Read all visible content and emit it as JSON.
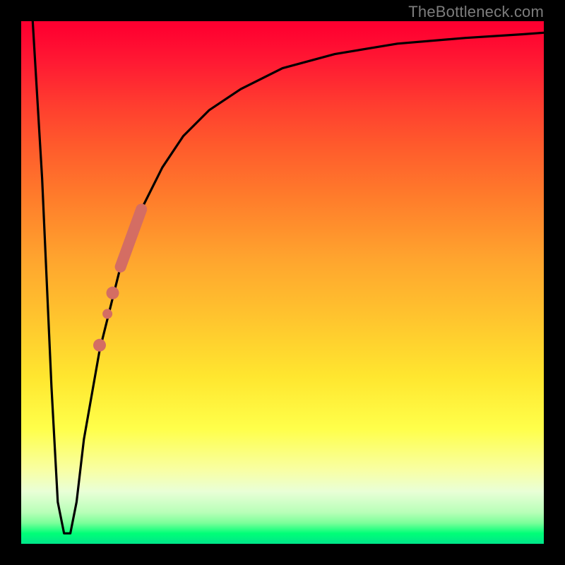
{
  "watermark": "TheBottleneck.com",
  "chart_data": {
    "type": "line",
    "title": "",
    "xlabel": "",
    "ylabel": "",
    "xlim": [
      0,
      1
    ],
    "ylim": [
      0,
      1
    ],
    "grid": false,
    "legend": false,
    "background_gradient": {
      "axis": "vertical",
      "stops": [
        {
          "pos": 0.0,
          "color": "#ff0030"
        },
        {
          "pos": 0.16,
          "color": "#ff3d2f"
        },
        {
          "pos": 0.34,
          "color": "#ff7d2b"
        },
        {
          "pos": 0.56,
          "color": "#ffc22e"
        },
        {
          "pos": 0.78,
          "color": "#ffff4a"
        },
        {
          "pos": 0.9,
          "color": "#e9ffd7"
        },
        {
          "pos": 1.0,
          "color": "#00e58a"
        }
      ]
    },
    "series": [
      {
        "name": "bottleneck-curve",
        "color": "#000000",
        "x": [
          0.022,
          0.04,
          0.058,
          0.07,
          0.082,
          0.094,
          0.106,
          0.12,
          0.15,
          0.19,
          0.23,
          0.27,
          0.31,
          0.36,
          0.42,
          0.5,
          0.6,
          0.72,
          0.85,
          0.96,
          1.0
        ],
        "y": [
          1.0,
          0.7,
          0.3,
          0.08,
          0.02,
          0.02,
          0.08,
          0.2,
          0.37,
          0.53,
          0.64,
          0.72,
          0.78,
          0.83,
          0.87,
          0.91,
          0.937,
          0.957,
          0.968,
          0.975,
          0.978
        ]
      }
    ],
    "markers": [
      {
        "name": "highlight-segment",
        "shape": "thick-line",
        "color": "#d46d63",
        "x": [
          0.19,
          0.23
        ],
        "y": [
          0.53,
          0.64
        ],
        "size": 16
      },
      {
        "name": "dot-1",
        "shape": "circle",
        "color": "#d46d63",
        "x": 0.175,
        "y": 0.48,
        "r": 9
      },
      {
        "name": "dot-2",
        "shape": "circle",
        "color": "#d46d63",
        "x": 0.165,
        "y": 0.44,
        "r": 7
      },
      {
        "name": "dot-3",
        "shape": "circle",
        "color": "#d46d63",
        "x": 0.15,
        "y": 0.38,
        "r": 9
      }
    ]
  }
}
